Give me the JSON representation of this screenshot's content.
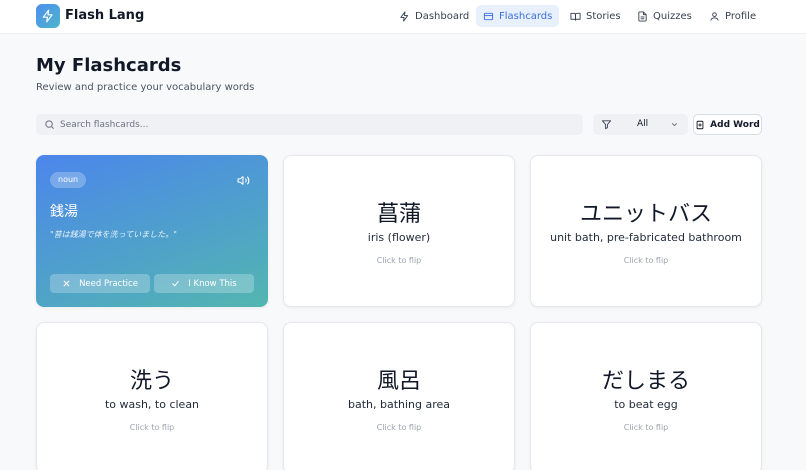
{
  "app": {
    "name": "Flash Lang"
  },
  "nav": [
    {
      "label": "Dashboard",
      "icon": "lightning-icon",
      "active": false
    },
    {
      "label": "Flashcards",
      "icon": "card-icon",
      "active": true
    },
    {
      "label": "Stories",
      "icon": "book-icon",
      "active": false
    },
    {
      "label": "Quizzes",
      "icon": "document-icon",
      "active": false
    },
    {
      "label": "Profile",
      "icon": "user-icon",
      "active": false
    }
  ],
  "page": {
    "title": "My Flashcards",
    "subtitle": "Review and practice your vocabulary words"
  },
  "search": {
    "placeholder": "Search flashcards...",
    "value": ""
  },
  "filter": {
    "selected": "All"
  },
  "add_button": {
    "label": "Add Word"
  },
  "flipped_card": {
    "part_of_speech": "noun",
    "word": "銭湯",
    "example": "\"昔は銭湯で体を洗っていました。\"",
    "need_practice_label": "Need Practice",
    "know_label": "I Know This"
  },
  "cards": [
    {
      "word": "菖蒲",
      "meaning": "iris (flower)",
      "hint": "Click to flip"
    },
    {
      "word": "ユニットバス",
      "meaning": "unit bath, pre-fabricated bathroom",
      "hint": "Click to flip"
    },
    {
      "word": "洗う",
      "meaning": "to wash, to clean",
      "hint": "Click to flip"
    },
    {
      "word": "風呂",
      "meaning": "bath, bathing area",
      "hint": "Click to flip"
    },
    {
      "word": "だしまる",
      "meaning": "to beat egg",
      "hint": "Click to flip"
    }
  ],
  "colors": {
    "accent": "#3b6fd6",
    "active_nav_bg": "#e8f0fd",
    "card_gradient_start": "#4b86ec",
    "card_gradient_end": "#52b6b0"
  }
}
